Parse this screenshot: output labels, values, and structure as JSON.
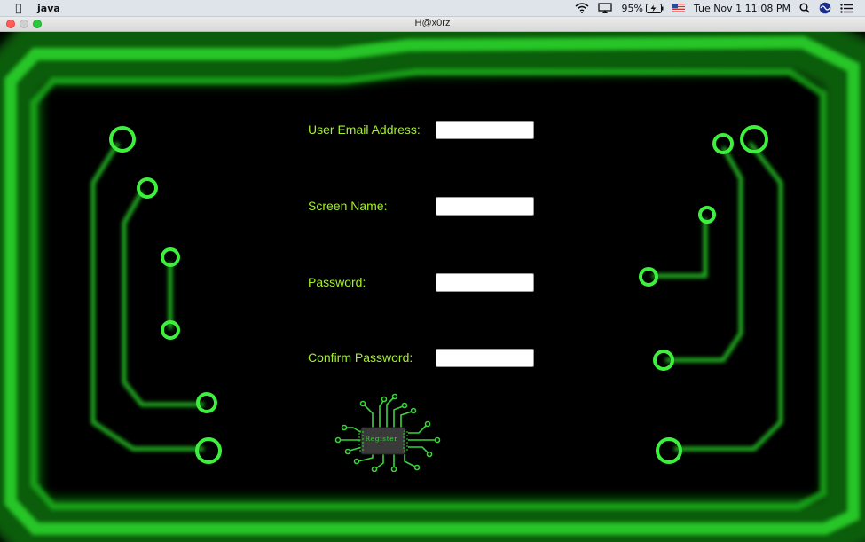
{
  "menubar": {
    "apple_icon": "apple-logo-icon",
    "app_name": "java",
    "battery": "95%",
    "datetime": "Tue Nov 1  11:08 PM"
  },
  "window": {
    "title": "H@x0rz"
  },
  "form": {
    "email_label": "User Email Address:",
    "email_value": "",
    "screen_name_label": "Screen Name:",
    "screen_name_value": "",
    "password_label": "Password:",
    "password_value": "",
    "confirm_label": "Confirm Password:",
    "confirm_value": "",
    "register_label": "Register"
  },
  "colors": {
    "label": "#a4f02b",
    "circuit_glow": "#1fbf1f",
    "background": "#000000"
  }
}
